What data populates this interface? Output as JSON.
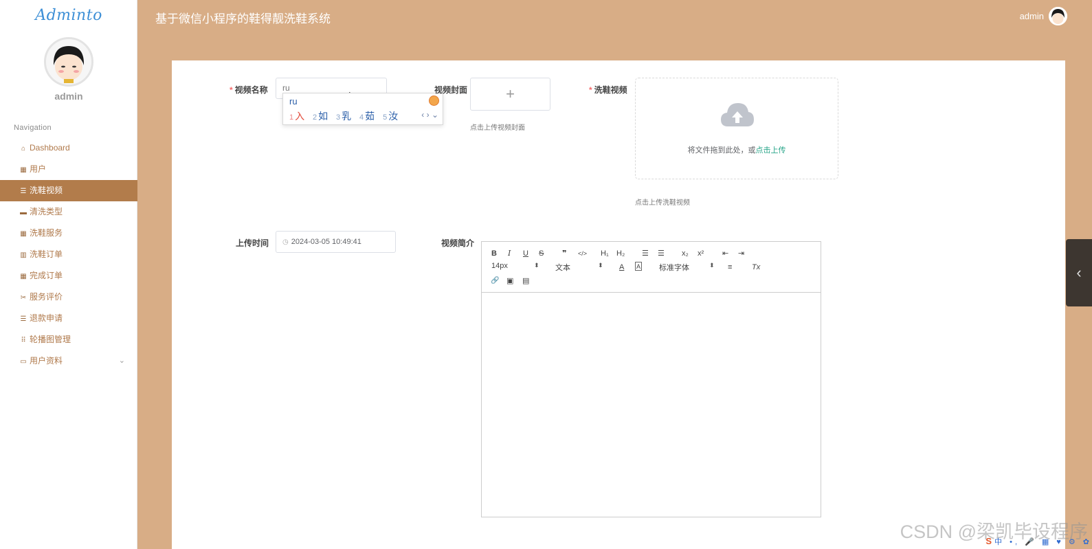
{
  "app": {
    "logo": "Adminto",
    "title": "基于微信小程序的鞋得靓洗鞋系统",
    "username": "admin",
    "top_username": "admin"
  },
  "sidebar": {
    "nav_title": "Navigation",
    "items": [
      {
        "label": "Dashboard",
        "icon": "home-icon"
      },
      {
        "label": "用户",
        "icon": "grid-icon"
      },
      {
        "label": "洗鞋视频",
        "icon": "list-icon",
        "active": true
      },
      {
        "label": "清洗类型",
        "icon": "monitor-icon"
      },
      {
        "label": "洗鞋服务",
        "icon": "grid-icon"
      },
      {
        "label": "洗鞋订单",
        "icon": "chart-icon"
      },
      {
        "label": "完成订单",
        "icon": "grid-icon"
      },
      {
        "label": "服务评价",
        "icon": "ticket-icon"
      },
      {
        "label": "退款申请",
        "icon": "list-icon"
      },
      {
        "label": "轮播图管理",
        "icon": "apps-icon"
      },
      {
        "label": "用户资料",
        "icon": "card-icon",
        "expandable": true
      }
    ]
  },
  "form": {
    "video_name_label": "视频名称",
    "video_name_value": "ru",
    "cover_label": "视频封面",
    "cover_plus": "+",
    "cover_hint": "点击上传视频封面",
    "video_label": "洗鞋视频",
    "drop_text": "将文件拖到此处，或",
    "drop_link": "点击上传",
    "video_hint": "点击上传洗鞋视频",
    "upload_time_label": "上传时间",
    "upload_time_value": "2024-03-05 10:49:41",
    "intro_label": "视频简介",
    "required_mark": "*"
  },
  "ime": {
    "typed": "ru",
    "candidates": [
      {
        "n": "1",
        "w": "入"
      },
      {
        "n": "2",
        "w": "如"
      },
      {
        "n": "3",
        "w": "乳"
      },
      {
        "n": "4",
        "w": "茹"
      },
      {
        "n": "5",
        "w": "汝"
      }
    ],
    "nav": "‹ › ⌄"
  },
  "editor": {
    "bold": "B",
    "italic": "I",
    "underline": "U",
    "strike": "S",
    "quote": "❞",
    "code": "</>",
    "h1": "H₁",
    "h2": "H₂",
    "ol": "☰",
    "ul": "☰",
    "sub": "x₂",
    "sup": "x²",
    "outdent": "⇤",
    "indent": "⇥",
    "size": "14px",
    "textstyle": "文本",
    "color": "A",
    "bg": "A",
    "font": "标准字体",
    "align": "≡",
    "clean": "Tx",
    "link": "🔗",
    "image": "▣",
    "video": "▤"
  },
  "watermark": "CSDN @梁凯毕设程序",
  "tray": {
    "s": "S",
    "rest": "中 •, 🎤 ▦ ♥ ⚙ ✿"
  }
}
